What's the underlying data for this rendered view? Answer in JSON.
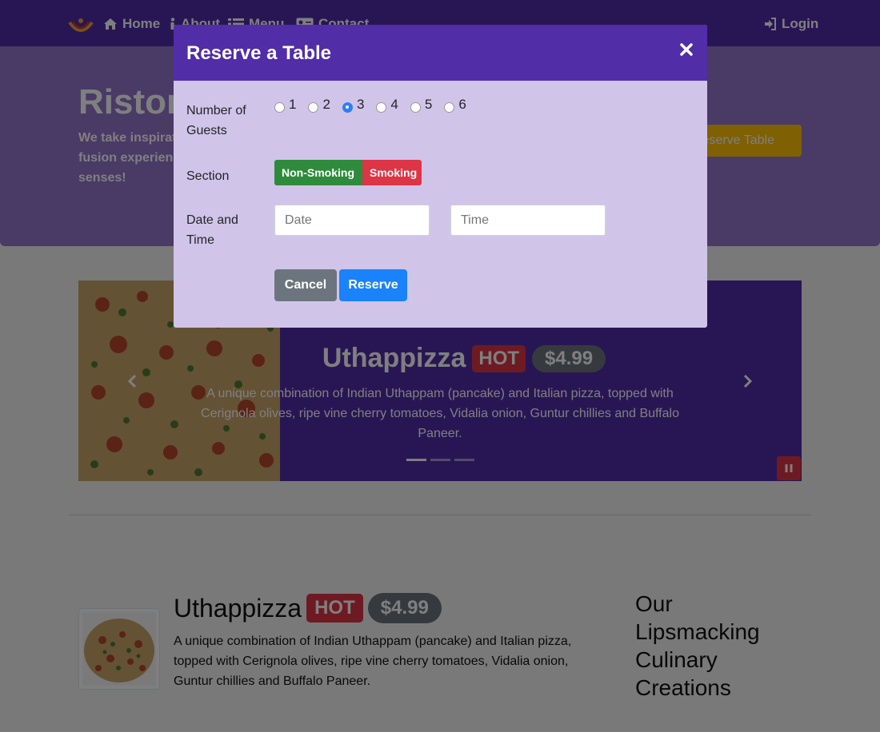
{
  "navbar": {
    "home": "Home",
    "about": "About",
    "menu": "Menu",
    "contact": "Contact",
    "login": "Login"
  },
  "jumbotron": {
    "title": "Ristorante con Fusion",
    "text": "We take inspiration from the World's best cuisines, and create a unique fusion experience. Our lipsmacking creations will tickle your culinary senses!",
    "button": "Reserve Table"
  },
  "carousel": {
    "title": "Uthappizza",
    "badge": "HOT",
    "price": "$4.99",
    "description": "A unique combination of Indian Uthappam (pancake) and Italian pizza, topped with Cerignola olives, ripe vine cherry tomatoes, Vidalia onion, Guntur chillies and Buffalo Paneer.",
    "indicators": 3,
    "active_indicator": 0
  },
  "featured": {
    "title": "Uthappizza",
    "badge": "HOT",
    "price": "$4.99",
    "description": "A unique combination of Indian Uthappam (pancake) and Italian pizza, topped with Cerignola olives, ripe vine cherry tomatoes, Vidalia onion, Guntur chillies and Buffalo Paneer."
  },
  "side_heading": "Our Lipsmacking Culinary Creations",
  "modal": {
    "title": "Reserve a Table",
    "guests_label": "Number of Guests",
    "guest_options": [
      "1",
      "2",
      "3",
      "4",
      "5",
      "6"
    ],
    "guests_selected": "3",
    "section_label": "Section",
    "section_options": [
      "Non-Smoking",
      "Smoking"
    ],
    "datetime_label": "Date and Time",
    "date_placeholder": "Date",
    "time_placeholder": "Time",
    "cancel": "Cancel",
    "reserve": "Reserve"
  },
  "colors": {
    "primary": "#512da8",
    "light": "#9575cd",
    "lighter": "#d1c4e9",
    "hot": "#dc3545",
    "price": "#6c757d",
    "success": "#2e8b3b",
    "reserve": "#1a82fb",
    "warning": "#ffc107"
  }
}
